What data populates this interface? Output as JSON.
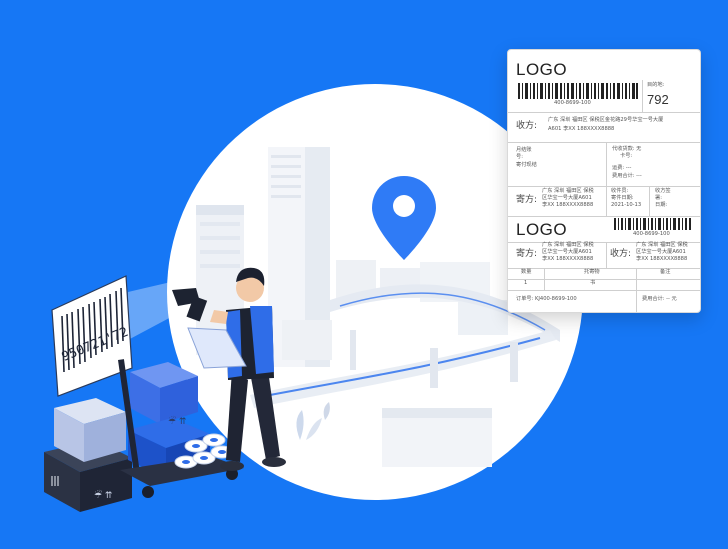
{
  "label": {
    "logo_top": "LOGO",
    "phone_top": "400-8699-100",
    "sort_label": "目的地:",
    "sort_code": "792",
    "receiver_label": "收方:",
    "receiver_addr_1": "广东 深圳 福田区 保税区金花路29号华宝一号大厦",
    "receiver_addr_2": "A601 李XX 188XXXX8888",
    "monthly_label_1": "月结账",
    "monthly_label_2": "号:",
    "monthly_label_3": "寄付现结",
    "cod_label": "代收货款: 无",
    "card_label": "卡号:",
    "insure_label": "运费: ---",
    "fee_total_label": "费用合计: ---",
    "sender_label": "寄方:",
    "sender_addr_1": "广东 深圳 福田区 保税",
    "sender_addr_2": "区华宝一号大厦A601",
    "sender_addr_3": "李XX 188XXXX8888",
    "courier_1": "收件员:",
    "courier_2": "寄件日期:",
    "courier_3": "2021-10-13",
    "sign_1": "收方签",
    "sign_2": "署:",
    "sign_3": "日期:",
    "logo_bottom": "LOGO",
    "phone_bottom": "400-8699-100",
    "sender2_label": "寄方:",
    "sender2_addr_1": "广东 深圳 福田区 保税",
    "sender2_addr_2": "区华宝一号大厦A601",
    "sender2_addr_3": "李XX 188XXXX8888",
    "receiver2_label": "收方:",
    "receiver2_addr_1": "广东 深圳 福田区 保税",
    "receiver2_addr_2": "区华宝一号大厦A601",
    "receiver2_addr_3": "李XX 188XXXX8888",
    "col_qty": "数量",
    "col_item": "托寄物",
    "col_note": "备注",
    "qty_value": "1",
    "item_value": "书",
    "order_label": "订单号: KJ400-8699-100",
    "fee_label": "费用合计: -- 元"
  },
  "barcode_card": {
    "number": "950721'72"
  },
  "box_labels": {
    "fragile_1": "☔ ⇈",
    "fragile_2": "☔ ⇈"
  },
  "colors": {
    "background": "#1677f5",
    "accent": "#2f7bf6"
  }
}
